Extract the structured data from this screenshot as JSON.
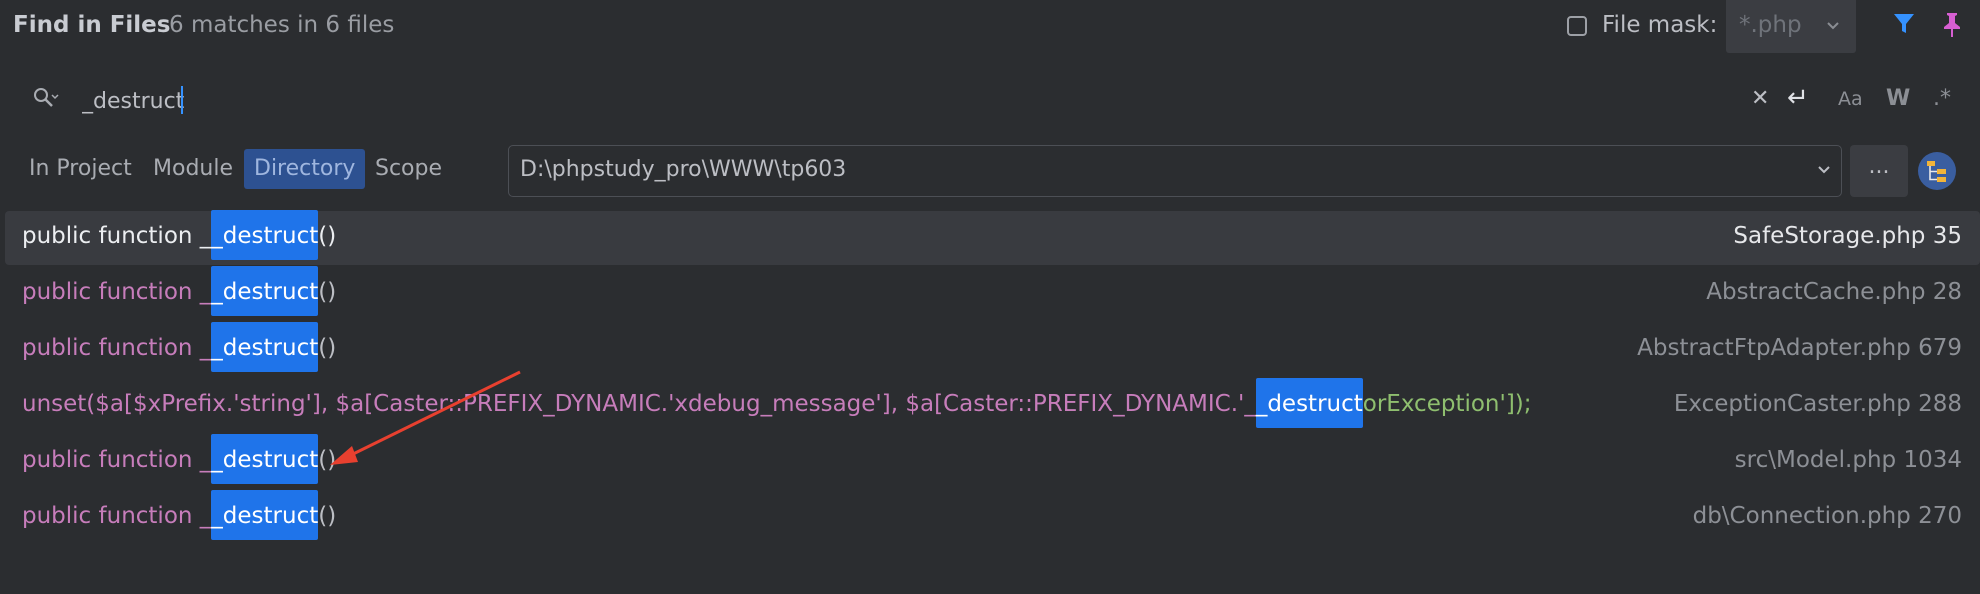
{
  "header": {
    "title": "Find in Files",
    "summary": "6 matches in 6 files",
    "file_mask_label": "File mask:",
    "file_mask_value": "*.php",
    "filter_icon": "filter-icon",
    "pin_icon": "pin-icon"
  },
  "search": {
    "query": "_destruct",
    "icons": [
      "search-history-icon",
      "clear-icon",
      "newline-icon",
      "match-case-icon",
      "words-icon",
      "regex-icon"
    ],
    "match_case_label": "Aa",
    "words_label": "W",
    "regex_label": ".*"
  },
  "scope": {
    "tabs": [
      "In Project",
      "Module",
      "Directory",
      "Scope"
    ],
    "active_tab": "Directory",
    "directory": "D:\\phpstudy_pro\\WWW\\tp603",
    "browse_label": "..."
  },
  "results": [
    {
      "pre": "public function _",
      "match": "_destruct",
      "post": "()",
      "file": "SafeStorage.php 35"
    },
    {
      "pre": "public function _",
      "match": "_destruct",
      "post": "()",
      "file": "AbstractCache.php 28"
    },
    {
      "pre": "public function _",
      "match": "_destruct",
      "post": "()",
      "file": "AbstractFtpAdapter.php 679"
    },
    {
      "pre": "unset($a[$xPrefix.'string'], $a[Caster::PREFIX_DYNAMIC.'xdebug_message'], $a[Caster::PREFIX_DYNAMIC.'_",
      "match": "_destruct",
      "post": "orException']);",
      "file": "ExceptionCaster.php 288"
    },
    {
      "pre": "public function _",
      "match": "_destruct",
      "post": "()",
      "file": "src\\Model.php 1034"
    },
    {
      "pre": "public function _",
      "match": "_destruct",
      "post": "()",
      "file": "db\\Connection.php 270"
    }
  ],
  "colors": {
    "background": "#2b2d30",
    "accent": "#3592ff",
    "match_highlight": "#1f74ea",
    "keyword": "#c77dbb",
    "string": "#8fbf6f",
    "variable": "#e46a6a",
    "annotation_arrow": "#e8402f"
  }
}
